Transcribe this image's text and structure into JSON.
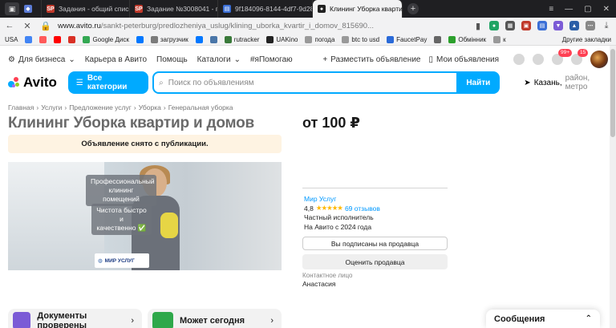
{
  "browser": {
    "tabs": [
      {
        "title": "",
        "fav_color": "#5b7bd5",
        "fav_glyph": "◆"
      },
      {
        "title": "Задания - общий список",
        "fav_color": "#c0392b",
        "fav_glyph": "SP"
      },
      {
        "title": "Задание №3008041 - пров",
        "fav_color": "#c0392b",
        "fav_glyph": "SP"
      },
      {
        "title": "9f184096-8144-4df7-9d28",
        "fav_color": "#3b6fd6",
        "fav_glyph": "▤"
      },
      {
        "title": "Клининг Уборка кварти",
        "fav_color": "#222222",
        "fav_glyph": "●"
      }
    ],
    "url_host": "www.avito.ru",
    "url_path": "/sankt-peterburg/predlozheniya_uslug/klining_uborka_kvartir_i_domov_815690...",
    "bookmarks": [
      {
        "label": "USA",
        "color": "#ffffff"
      },
      {
        "label": "",
        "color": "#4285f4"
      },
      {
        "label": "",
        "color": "#ff5a5a"
      },
      {
        "label": "",
        "color": "#ff0000"
      },
      {
        "label": "",
        "color": "#d93025"
      },
      {
        "label": "Google Диск",
        "color": "#34a853"
      },
      {
        "label": "",
        "color": "#0077ff"
      },
      {
        "label": "загрузчик",
        "color": "#7b7b7b"
      },
      {
        "label": "",
        "color": "#0077ff"
      },
      {
        "label": "",
        "color": "#4a76a8"
      },
      {
        "label": "rutracker",
        "color": "#3a7a3a"
      },
      {
        "label": "UAKino",
        "color": "#222222"
      },
      {
        "label": "погода",
        "color": "#999999"
      },
      {
        "label": "btc to usd",
        "color": "#999999"
      },
      {
        "label": "FaucetPay",
        "color": "#2a6ad8"
      },
      {
        "label": "",
        "color": "#666666"
      },
      {
        "label": "Обмінник",
        "color": "#2ca02c"
      },
      {
        "label": "к",
        "color": "#999999"
      }
    ],
    "bookmarks_other": "Другие закладки"
  },
  "site": {
    "top_nav": [
      "Для бизнеса",
      "Карьера в Авито",
      "Помощь",
      "Каталоги",
      "#яПомогаю"
    ],
    "place_ad": "Разместить объявление",
    "my_ads": "Мои объявления",
    "msg_badge": "99+",
    "cart_badge": "15",
    "logo_text": "Avito",
    "categories_button": "Все категории",
    "search_placeholder": "Поиск по объявлениям",
    "find_button": "Найти",
    "location_city": "Казань,",
    "location_rest": "район, метро"
  },
  "breadcrumbs": [
    "Главная",
    "Услуги",
    "Предложение услуг",
    "Уборка",
    "Генеральная уборка"
  ],
  "listing": {
    "title": "Клининг Уборка квартир и домов",
    "notice": "Объявление снято с публикации.",
    "price": "от 100 ₽",
    "promo_line1": "Профессиональный",
    "promo_line2": "клининг помещений",
    "promo_line3": "Чистота быстро и",
    "promo_line4": "качественно ✅",
    "promo_logo": "МИР УСЛУГ"
  },
  "seller": {
    "name": "Мир Услуг",
    "rating": "4,8",
    "stars": "★★★★★",
    "reviews": "69 отзывов",
    "type": "Частный исполнитель",
    "since": "На Авито с 2024 года",
    "subscribed_button": "Вы подписаны на продавца",
    "rate_button": "Оценить продавца",
    "contact_label": "Контактное лицо",
    "contact_name": "Анастасия"
  },
  "cards": [
    {
      "label": "Документы проверены",
      "color": "#7b5bd6"
    },
    {
      "label": "Может сегодня",
      "color": "#2ea84a"
    }
  ],
  "messages_panel": "Сообщения"
}
